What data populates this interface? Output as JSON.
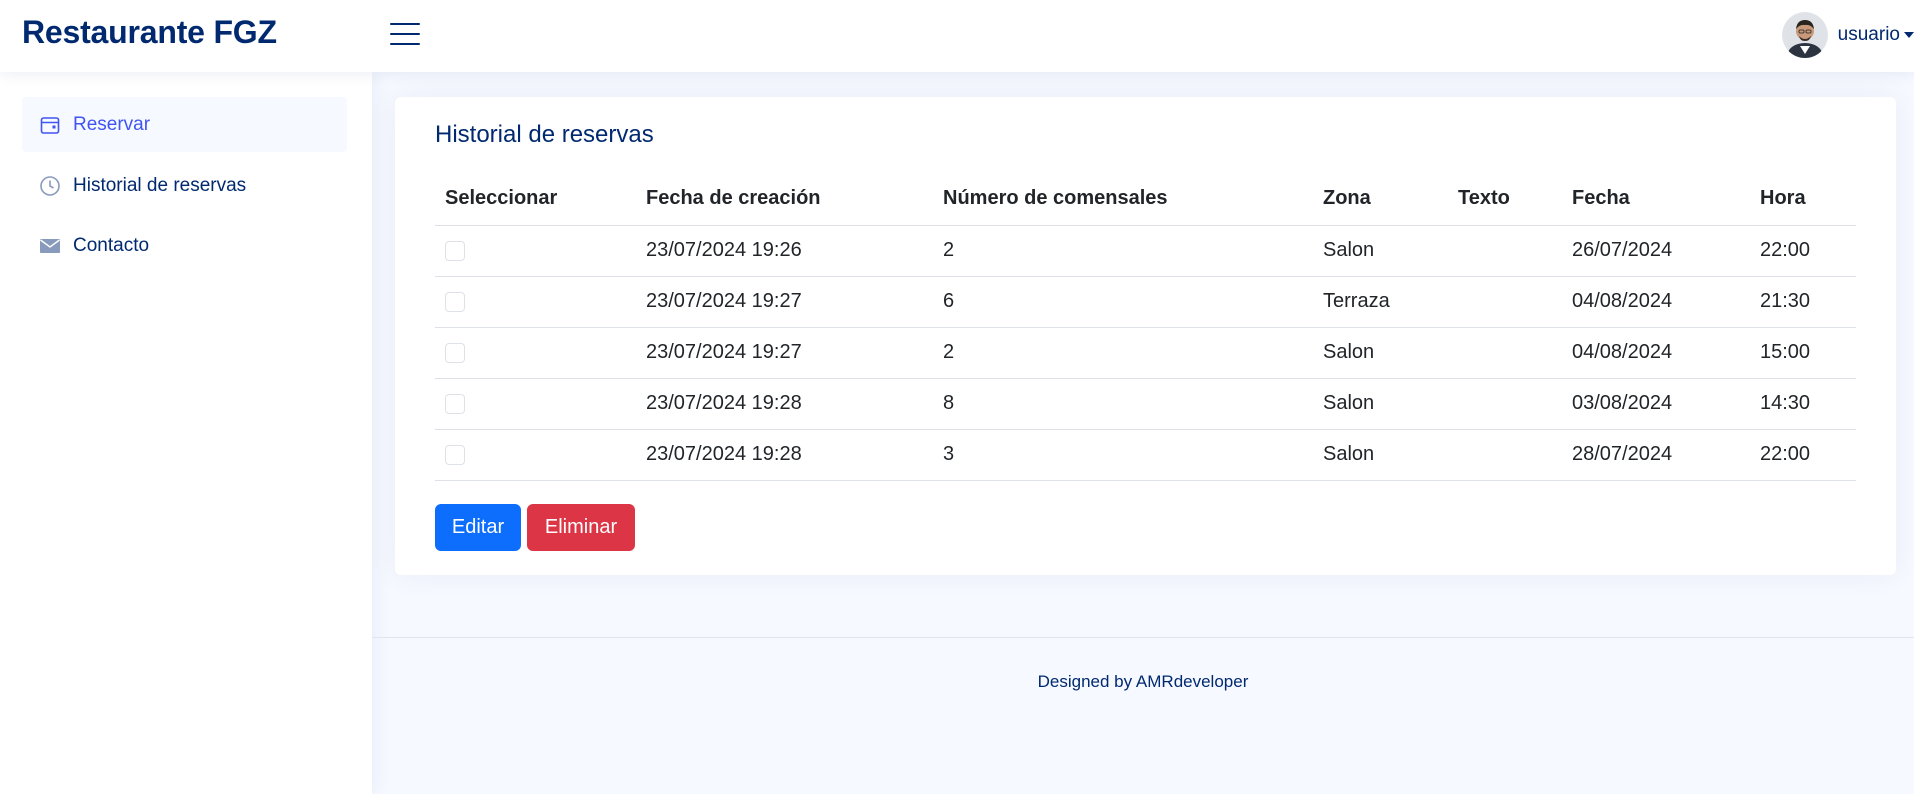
{
  "header": {
    "brand": "Restaurante FGZ",
    "user_name": "usuario"
  },
  "sidebar": {
    "items": [
      {
        "label": "Reservar",
        "icon": "calendar-icon",
        "active": true
      },
      {
        "label": "Historial de reservas",
        "icon": "clock-icon",
        "active": false
      },
      {
        "label": "Contacto",
        "icon": "envelope-icon",
        "active": false
      }
    ]
  },
  "main": {
    "title": "Historial de reservas",
    "table": {
      "headers": [
        "Seleccionar",
        "Fecha de creación",
        "Número de comensales",
        "Zona",
        "Texto",
        "Fecha",
        "Hora"
      ],
      "rows": [
        {
          "creado": "23/07/2024 19:26",
          "comensales": "2",
          "zona": "Salon",
          "texto": "",
          "fecha": "26/07/2024",
          "hora": "22:00"
        },
        {
          "creado": "23/07/2024 19:27",
          "comensales": "6",
          "zona": "Terraza",
          "texto": "",
          "fecha": "04/08/2024",
          "hora": "21:30"
        },
        {
          "creado": "23/07/2024 19:27",
          "comensales": "2",
          "zona": "Salon",
          "texto": "",
          "fecha": "04/08/2024",
          "hora": "15:00"
        },
        {
          "creado": "23/07/2024 19:28",
          "comensales": "8",
          "zona": "Salon",
          "texto": "",
          "fecha": "03/08/2024",
          "hora": "14:30"
        },
        {
          "creado": "23/07/2024 19:28",
          "comensales": "3",
          "zona": "Salon",
          "texto": "",
          "fecha": "28/07/2024",
          "hora": "22:00"
        }
      ]
    },
    "buttons": {
      "edit": "Editar",
      "delete": "Eliminar"
    }
  },
  "footer": {
    "credit": "Designed by AMRdeveloper"
  },
  "colors": {
    "brand": "#012970",
    "accent": "#4154f1",
    "primary": "#0d6efd",
    "danger": "#dc3545",
    "background": "#f6f9ff"
  }
}
